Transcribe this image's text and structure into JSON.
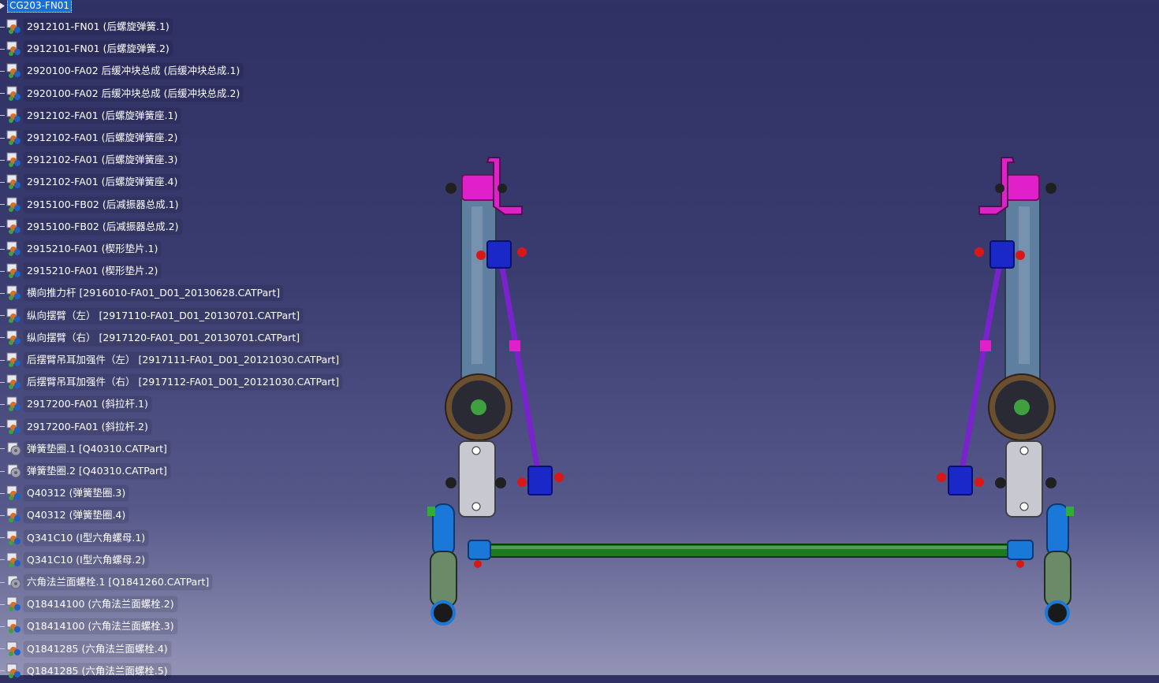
{
  "tree": {
    "root_label": "CG203-FN01",
    "nodes": [
      {
        "label": "2912101-FN01 (后螺旋弹簧.1)",
        "icon": "product-icon"
      },
      {
        "label": "2912101-FN01 (后螺旋弹簧.2)",
        "icon": "product-icon"
      },
      {
        "label": "2920100-FA02 后缓冲块总成 (后缓冲块总成.1)",
        "icon": "product-icon"
      },
      {
        "label": "2920100-FA02 后缓冲块总成 (后缓冲块总成.2)",
        "icon": "product-icon"
      },
      {
        "label": "2912102-FA01 (后螺旋弹簧座.1)",
        "icon": "product-icon"
      },
      {
        "label": "2912102-FA01 (后螺旋弹簧座.2)",
        "icon": "product-icon"
      },
      {
        "label": "2912102-FA01 (后螺旋弹簧座.3)",
        "icon": "product-icon"
      },
      {
        "label": "2912102-FA01 (后螺旋弹簧座.4)",
        "icon": "product-icon"
      },
      {
        "label": "2915100-FB02 (后减振器总成.1)",
        "icon": "product-icon"
      },
      {
        "label": "2915100-FB02 (后减振器总成.2)",
        "icon": "product-icon"
      },
      {
        "label": "2915210-FA01 (楔形垫片.1)",
        "icon": "product-icon"
      },
      {
        "label": "2915210-FA01 (楔形垫片.2)",
        "icon": "product-icon"
      },
      {
        "label": "横向推力杆 [2916010-FA01_D01_20130628.CATPart]",
        "icon": "product-icon"
      },
      {
        "label": "纵向摆臂（左） [2917110-FA01_D01_20130701.CATPart]",
        "icon": "product-icon"
      },
      {
        "label": "纵向摆臂（右） [2917120-FA01_D01_20130701.CATPart]",
        "icon": "product-icon"
      },
      {
        "label": "后摆臂吊耳加强件（左） [2917111-FA01_D01_20121030.CATPart]",
        "icon": "product-icon"
      },
      {
        "label": "后摆臂吊耳加强件（右） [2917112-FA01_D01_20121030.CATPart]",
        "icon": "product-icon"
      },
      {
        "label": "2917200-FA01 (斜拉杆.1)",
        "icon": "product-icon"
      },
      {
        "label": "2917200-FA01 (斜拉杆.2)",
        "icon": "product-icon"
      },
      {
        "label": "弹簧垫圈.1 [Q40310.CATPart]",
        "icon": "part-icon"
      },
      {
        "label": "弹簧垫圈.2 [Q40310.CATPart]",
        "icon": "part-icon"
      },
      {
        "label": "Q40312 (弹簧垫圈.3)",
        "icon": "product-icon"
      },
      {
        "label": "Q40312 (弹簧垫圈.4)",
        "icon": "product-icon"
      },
      {
        "label": "Q341C10 (I型六角螺母.1)",
        "icon": "product-icon"
      },
      {
        "label": "Q341C10 (I型六角螺母.2)",
        "icon": "product-icon"
      },
      {
        "label": "六角法兰面螺栓.1 [Q1841260.CATPart]",
        "icon": "part-icon"
      },
      {
        "label": "Q18414100 (六角法兰面螺栓.2)",
        "icon": "product-icon"
      },
      {
        "label": "Q18414100 (六角法兰面螺栓.3)",
        "icon": "product-icon"
      },
      {
        "label": "Q1841285 (六角法兰面螺栓.4)",
        "icon": "product-icon"
      },
      {
        "label": "Q1841285 (六角法兰面螺栓.5)",
        "icon": "product-icon"
      }
    ]
  },
  "colors": {
    "arm": "#5f7fa0",
    "bushing": "#e020c8",
    "link": "#7a22cc",
    "link_end": "#1a28c8",
    "bolt": "#d81818",
    "spring_seat": "#6a5030",
    "bracket": "#c8c8d0",
    "shock_upper": "#1a78d8",
    "shock_lower": "#6a8a68",
    "panhard": "#1e7a1e"
  }
}
